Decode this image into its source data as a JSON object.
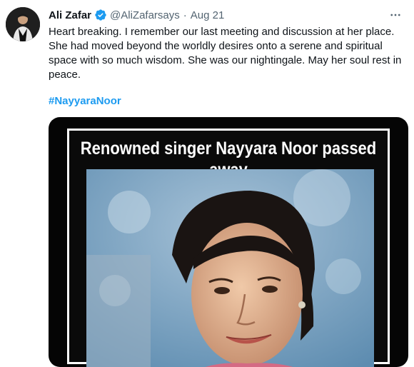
{
  "tweet": {
    "author_name": "Ali Zafar",
    "handle": "@AliZafarsays",
    "separator": "·",
    "date": "Aug 21",
    "text": "Heart breaking. I remember our last meeting and discussion at her place. She had moved beyond the worldly desires onto a serene and spiritual space with so much wisdom. She was our nightingale. May her soul rest in peace.",
    "hashtag": "#NayyaraNoor",
    "more_icon": "more-horizontal-icon",
    "verified_icon": "verified-badge-icon"
  },
  "media": {
    "headline": "Renowned singer Nayyara Noor passed away"
  },
  "colors": {
    "link": "#1d9bf0",
    "verified": "#1d9bf0",
    "secondary_text": "#536471",
    "primary_text": "#0f1419"
  }
}
